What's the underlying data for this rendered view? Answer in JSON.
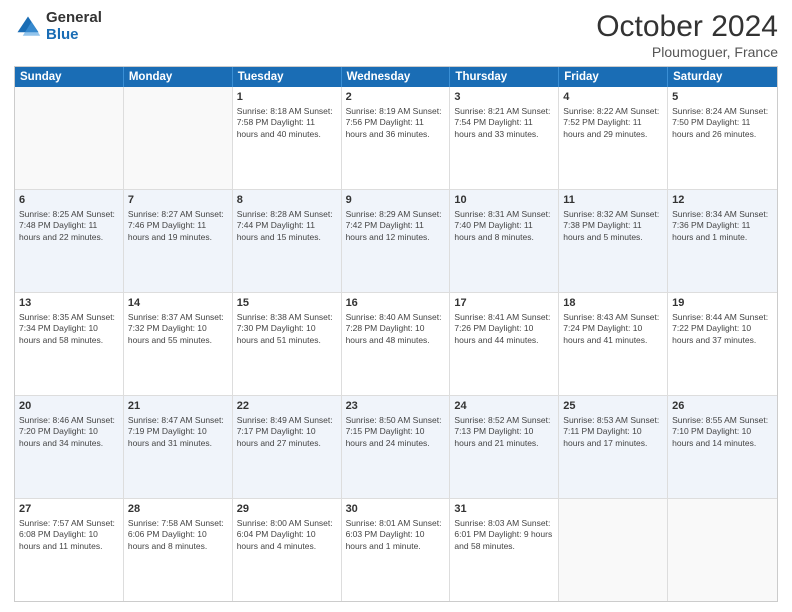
{
  "header": {
    "logo_general": "General",
    "logo_blue": "Blue",
    "month": "October 2024",
    "location": "Ploumoguer, France"
  },
  "days_of_week": [
    "Sunday",
    "Monday",
    "Tuesday",
    "Wednesday",
    "Thursday",
    "Friday",
    "Saturday"
  ],
  "weeks": [
    [
      {
        "day": "",
        "info": ""
      },
      {
        "day": "",
        "info": ""
      },
      {
        "day": "1",
        "info": "Sunrise: 8:18 AM\nSunset: 7:58 PM\nDaylight: 11 hours and 40 minutes."
      },
      {
        "day": "2",
        "info": "Sunrise: 8:19 AM\nSunset: 7:56 PM\nDaylight: 11 hours and 36 minutes."
      },
      {
        "day": "3",
        "info": "Sunrise: 8:21 AM\nSunset: 7:54 PM\nDaylight: 11 hours and 33 minutes."
      },
      {
        "day": "4",
        "info": "Sunrise: 8:22 AM\nSunset: 7:52 PM\nDaylight: 11 hours and 29 minutes."
      },
      {
        "day": "5",
        "info": "Sunrise: 8:24 AM\nSunset: 7:50 PM\nDaylight: 11 hours and 26 minutes."
      }
    ],
    [
      {
        "day": "6",
        "info": "Sunrise: 8:25 AM\nSunset: 7:48 PM\nDaylight: 11 hours and 22 minutes."
      },
      {
        "day": "7",
        "info": "Sunrise: 8:27 AM\nSunset: 7:46 PM\nDaylight: 11 hours and 19 minutes."
      },
      {
        "day": "8",
        "info": "Sunrise: 8:28 AM\nSunset: 7:44 PM\nDaylight: 11 hours and 15 minutes."
      },
      {
        "day": "9",
        "info": "Sunrise: 8:29 AM\nSunset: 7:42 PM\nDaylight: 11 hours and 12 minutes."
      },
      {
        "day": "10",
        "info": "Sunrise: 8:31 AM\nSunset: 7:40 PM\nDaylight: 11 hours and 8 minutes."
      },
      {
        "day": "11",
        "info": "Sunrise: 8:32 AM\nSunset: 7:38 PM\nDaylight: 11 hours and 5 minutes."
      },
      {
        "day": "12",
        "info": "Sunrise: 8:34 AM\nSunset: 7:36 PM\nDaylight: 11 hours and 1 minute."
      }
    ],
    [
      {
        "day": "13",
        "info": "Sunrise: 8:35 AM\nSunset: 7:34 PM\nDaylight: 10 hours and 58 minutes."
      },
      {
        "day": "14",
        "info": "Sunrise: 8:37 AM\nSunset: 7:32 PM\nDaylight: 10 hours and 55 minutes."
      },
      {
        "day": "15",
        "info": "Sunrise: 8:38 AM\nSunset: 7:30 PM\nDaylight: 10 hours and 51 minutes."
      },
      {
        "day": "16",
        "info": "Sunrise: 8:40 AM\nSunset: 7:28 PM\nDaylight: 10 hours and 48 minutes."
      },
      {
        "day": "17",
        "info": "Sunrise: 8:41 AM\nSunset: 7:26 PM\nDaylight: 10 hours and 44 minutes."
      },
      {
        "day": "18",
        "info": "Sunrise: 8:43 AM\nSunset: 7:24 PM\nDaylight: 10 hours and 41 minutes."
      },
      {
        "day": "19",
        "info": "Sunrise: 8:44 AM\nSunset: 7:22 PM\nDaylight: 10 hours and 37 minutes."
      }
    ],
    [
      {
        "day": "20",
        "info": "Sunrise: 8:46 AM\nSunset: 7:20 PM\nDaylight: 10 hours and 34 minutes."
      },
      {
        "day": "21",
        "info": "Sunrise: 8:47 AM\nSunset: 7:19 PM\nDaylight: 10 hours and 31 minutes."
      },
      {
        "day": "22",
        "info": "Sunrise: 8:49 AM\nSunset: 7:17 PM\nDaylight: 10 hours and 27 minutes."
      },
      {
        "day": "23",
        "info": "Sunrise: 8:50 AM\nSunset: 7:15 PM\nDaylight: 10 hours and 24 minutes."
      },
      {
        "day": "24",
        "info": "Sunrise: 8:52 AM\nSunset: 7:13 PM\nDaylight: 10 hours and 21 minutes."
      },
      {
        "day": "25",
        "info": "Sunrise: 8:53 AM\nSunset: 7:11 PM\nDaylight: 10 hours and 17 minutes."
      },
      {
        "day": "26",
        "info": "Sunrise: 8:55 AM\nSunset: 7:10 PM\nDaylight: 10 hours and 14 minutes."
      }
    ],
    [
      {
        "day": "27",
        "info": "Sunrise: 7:57 AM\nSunset: 6:08 PM\nDaylight: 10 hours and 11 minutes."
      },
      {
        "day": "28",
        "info": "Sunrise: 7:58 AM\nSunset: 6:06 PM\nDaylight: 10 hours and 8 minutes."
      },
      {
        "day": "29",
        "info": "Sunrise: 8:00 AM\nSunset: 6:04 PM\nDaylight: 10 hours and 4 minutes."
      },
      {
        "day": "30",
        "info": "Sunrise: 8:01 AM\nSunset: 6:03 PM\nDaylight: 10 hours and 1 minute."
      },
      {
        "day": "31",
        "info": "Sunrise: 8:03 AM\nSunset: 6:01 PM\nDaylight: 9 hours and 58 minutes."
      },
      {
        "day": "",
        "info": ""
      },
      {
        "day": "",
        "info": ""
      }
    ]
  ]
}
